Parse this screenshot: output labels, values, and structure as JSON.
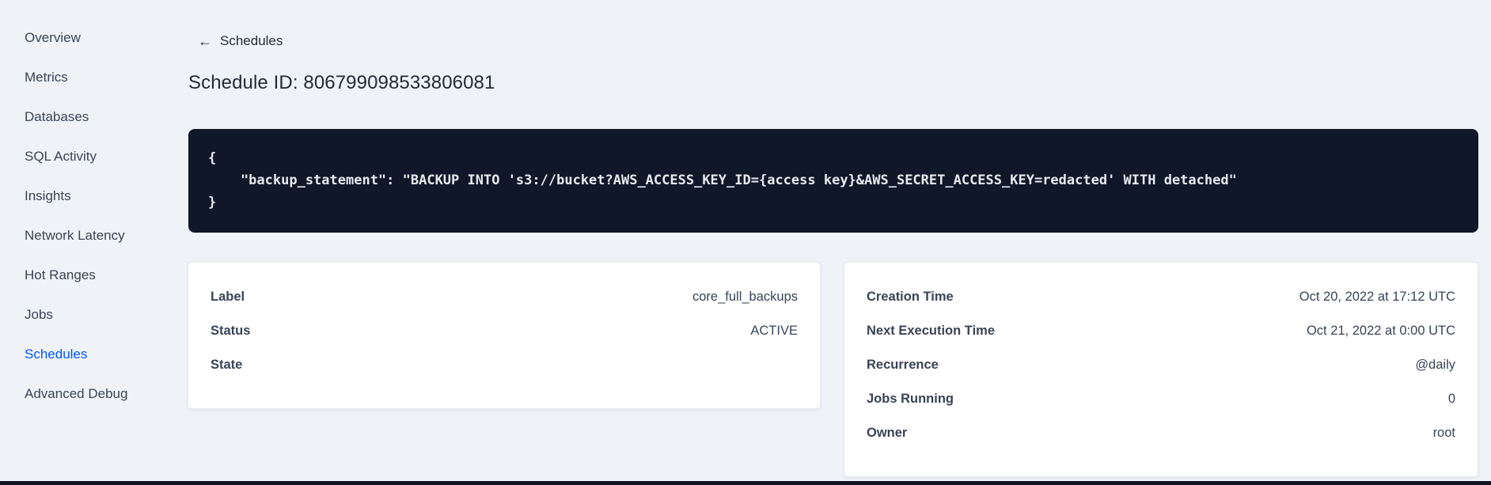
{
  "sidebar": {
    "items": [
      {
        "label": "Overview",
        "active": false
      },
      {
        "label": "Metrics",
        "active": false
      },
      {
        "label": "Databases",
        "active": false
      },
      {
        "label": "SQL Activity",
        "active": false
      },
      {
        "label": "Insights",
        "active": false
      },
      {
        "label": "Network Latency",
        "active": false
      },
      {
        "label": "Hot Ranges",
        "active": false
      },
      {
        "label": "Jobs",
        "active": false
      },
      {
        "label": "Schedules",
        "active": true
      },
      {
        "label": "Advanced Debug",
        "active": false
      }
    ]
  },
  "header": {
    "back_icon": "←",
    "back_label": "Schedules",
    "title": "Schedule ID: 806799098533806081"
  },
  "code_block": {
    "lines": [
      "{",
      "    \"backup_statement\": \"BACKUP INTO 's3://bucket?AWS_ACCESS_KEY_ID={access key}&AWS_SECRET_ACCESS_KEY=redacted' WITH detached\"",
      "}"
    ]
  },
  "meta_card": {
    "rows": [
      {
        "label": "Label",
        "value": "core_full_backups"
      },
      {
        "label": "Status",
        "value": "ACTIVE"
      },
      {
        "label": "State",
        "value": ""
      }
    ]
  },
  "timing_card": {
    "rows": [
      {
        "label": "Creation Time",
        "value": "Oct 20, 2022 at 17:12 UTC"
      },
      {
        "label": "Next Execution Time",
        "value": "Oct 21, 2022 at 0:00 UTC"
      },
      {
        "label": "Recurrence",
        "value": "@daily"
      },
      {
        "label": "Jobs Running",
        "value": "0"
      },
      {
        "label": "Owner",
        "value": "root"
      }
    ]
  },
  "colors": {
    "accent": "#0055ff",
    "code_background": "#0f1728",
    "page_background": "#eff3f7"
  }
}
